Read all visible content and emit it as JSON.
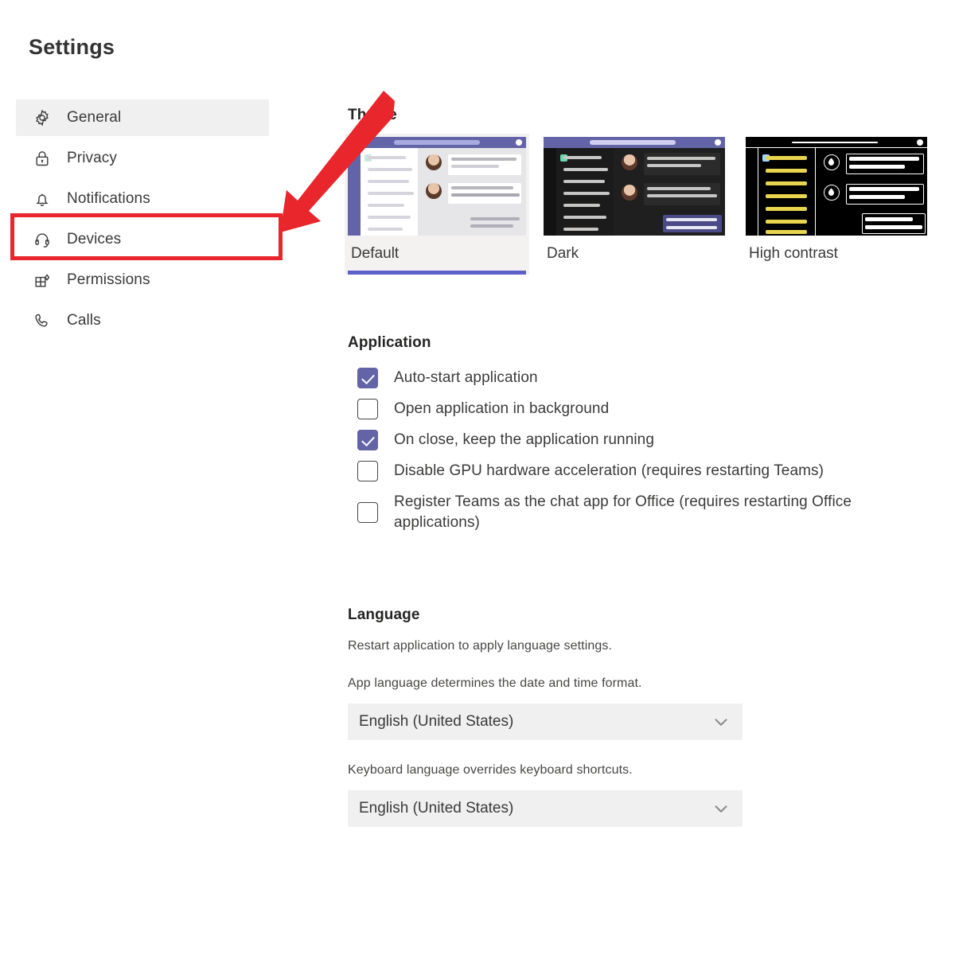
{
  "page": {
    "title": "Settings"
  },
  "sidebar": {
    "items": [
      {
        "label": "General",
        "icon": "gear-icon",
        "selected": true
      },
      {
        "label": "Privacy",
        "icon": "lock-icon",
        "selected": false
      },
      {
        "label": "Notifications",
        "icon": "bell-icon",
        "selected": false
      },
      {
        "label": "Devices",
        "icon": "headset-icon",
        "selected": false
      },
      {
        "label": "Permissions",
        "icon": "permissions-grid-icon",
        "selected": false
      },
      {
        "label": "Calls",
        "icon": "phone-icon",
        "selected": false
      }
    ]
  },
  "theme": {
    "heading": "Theme",
    "options": [
      {
        "label": "Default",
        "selected": true
      },
      {
        "label": "Dark",
        "selected": false
      },
      {
        "label": "High contrast",
        "selected": false
      }
    ]
  },
  "application": {
    "heading": "Application",
    "checkboxes": [
      {
        "label": "Auto-start application",
        "checked": true
      },
      {
        "label": "Open application in background",
        "checked": false
      },
      {
        "label": "On close, keep the application running",
        "checked": true
      },
      {
        "label": "Disable GPU hardware acceleration (requires restarting Teams)",
        "checked": false
      },
      {
        "label": "Register Teams as the chat app for Office (requires restarting Office applications)",
        "checked": false
      }
    ]
  },
  "language": {
    "heading": "Language",
    "restart_note": "Restart application to apply language settings.",
    "app_language_hint": "App language determines the date and time format.",
    "app_language_value": "English (United States)",
    "keyboard_language_hint": "Keyboard language overrides keyboard shortcuts.",
    "keyboard_language_value": "English (United States)"
  },
  "annotations": {
    "highlight_color": "#e8262c",
    "arrow_color": "#e8262c",
    "highlighted_item": "Devices"
  },
  "colors": {
    "accent_purple": "#5b5fc7",
    "checkbox_purple": "#6264a7",
    "selected_row_gray": "#f0f0f0",
    "annotation_red": "#e8262c"
  }
}
